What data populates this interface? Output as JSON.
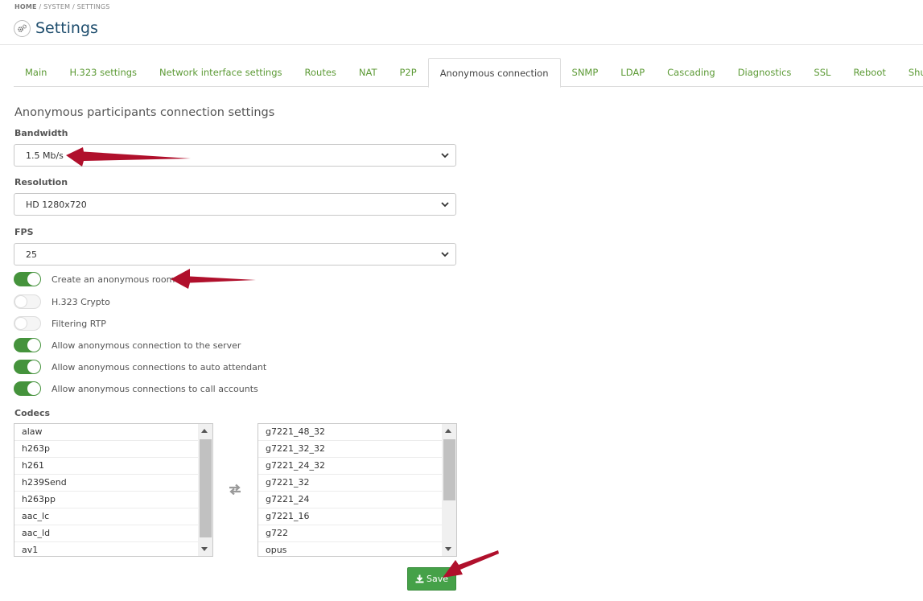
{
  "breadcrumb": {
    "home": "HOME",
    "rest": " / SYSTEM / SETTINGS"
  },
  "page": {
    "title": "Settings"
  },
  "tabs": [
    {
      "label": "Main"
    },
    {
      "label": "H.323 settings"
    },
    {
      "label": "Network interface settings"
    },
    {
      "label": "Routes"
    },
    {
      "label": "NAT"
    },
    {
      "label": "P2P"
    },
    {
      "label": "Anonymous connection",
      "active": true
    },
    {
      "label": "SNMP"
    },
    {
      "label": "LDAP"
    },
    {
      "label": "Cascading"
    },
    {
      "label": "Diagnostics"
    },
    {
      "label": "SSL"
    },
    {
      "label": "Reboot"
    },
    {
      "label": "Shutdown"
    }
  ],
  "form": {
    "section_title": "Anonymous participants connection settings",
    "bandwidth": {
      "label": "Bandwidth",
      "value": "1.5 Mb/s"
    },
    "resolution": {
      "label": "Resolution",
      "value": "HD 1280x720"
    },
    "fps": {
      "label": "FPS",
      "value": "25"
    },
    "toggles": [
      {
        "label": "Create an anonymous room",
        "on": true
      },
      {
        "label": "H.323 Crypto",
        "on": false
      },
      {
        "label": "Filtering RTP",
        "on": false
      },
      {
        "label": "Allow anonymous connection to the server",
        "on": true
      },
      {
        "label": "Allow anonymous connections to auto attendant",
        "on": true
      },
      {
        "label": "Allow anonymous connections to call accounts",
        "on": true
      }
    ],
    "codecs_label": "Codecs",
    "codecs_available": [
      "alaw",
      "h263p",
      "h261",
      "h239Send",
      "h263pp",
      "aac_lc",
      "aac_ld",
      "av1"
    ],
    "codecs_selected": [
      "g7221_48_32",
      "g7221_32_32",
      "g7221_24_32",
      "g7221_32",
      "g7221_24",
      "g7221_16",
      "g722",
      "opus"
    ],
    "save_label": "Save"
  },
  "colors": {
    "accent": "#45933c",
    "tab_text": "#5c9a35",
    "title": "#1f4e6e",
    "annotation_arrow": "#b0102c"
  }
}
